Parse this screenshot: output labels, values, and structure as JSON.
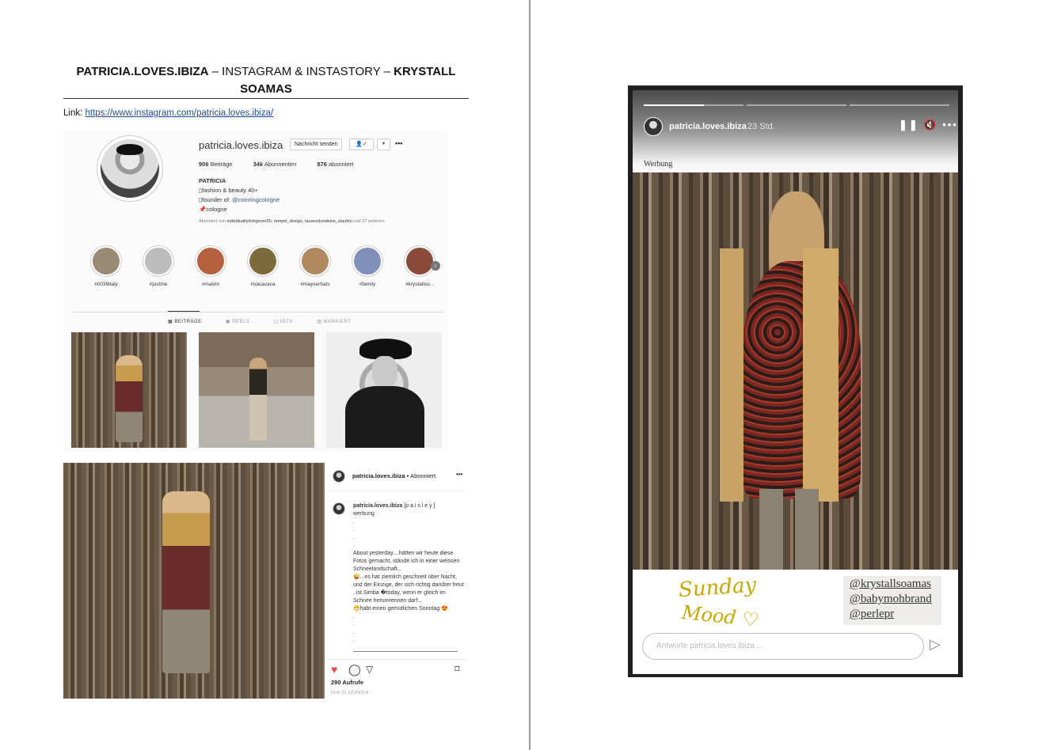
{
  "document": {
    "title_part1": "PATRICIA.LOVES.IBIZA",
    "title_part2": " – INSTAGRAM & INSTASTORY – ",
    "title_part3": "KRYSTALL SOAMAS",
    "link_label": "Link: ",
    "link_url": "https://www.instagram.com/patricia.loves.ibiza/"
  },
  "profile": {
    "username": "patricia.loves.ibiza",
    "message_button": "Nachricht senden",
    "follow_button": "👤✓",
    "dropdown_button": "▾",
    "more_button": "•••",
    "posts_count": "906",
    "posts_label": " Beiträge",
    "followers_count": "34k",
    "followers_label": " Abonnenten",
    "following_count": "876",
    "following_label": " abonniert",
    "bio_name": "PATRICIA",
    "bio_line1": "▯fashion & beauty 40+",
    "bio_line2_prefix": "▯founder of: ",
    "bio_line2_mention": "@coinringcologne",
    "bio_line3": "📌cologne",
    "followed_by_prefix": "Abonniert von ",
    "followed_by_names": "individuallylivingover50, rempel_design, tausendundeins_staufen",
    "followed_by_suffix": " und 37 weiteren",
    "highlights": [
      {
        "label": "#0039italy",
        "color": "#9a8a74"
      },
      {
        "label": "#justme",
        "color": "#bcbcbc"
      },
      {
        "label": "#malvin",
        "color": "#b5603f"
      },
      {
        "label": "#vacavaca",
        "color": "#7d6a3c"
      },
      {
        "label": "#mayserhats",
        "color": "#b08a5e"
      },
      {
        "label": "#family",
        "color": "#7f8fb8"
      },
      {
        "label": "#krystallso...",
        "color": "#8a4a3a"
      }
    ],
    "next_arrow": "›",
    "tabs": [
      "▦ BEITRÄGE",
      "▣ REELS",
      "▢ IGTV",
      "▥ MARKIERT"
    ]
  },
  "post": {
    "username": "patricia.loves.ibiza",
    "follow_state": " • Abonniert",
    "more_button": "•••",
    "caption_user": "patricia.loves.ibiza",
    "caption_body": " [p a i s l e y ]\nwerbung\n.\n.\n.\n.\nAbout yesterday....hätten wir heute diese Fotos gemacht, stände ich in einer weissen Schneelandschaft...\n😜...es hat ziemlich geschneit über Nacht, und der Einzige, der sich richtig darüber freut , ist Simba �today, wenn er gleich im Schnee herumrennen darf...\n😁habt einen gemütlichen Sonntag 😍\n.\n.\n.\n.",
    "views_count": "290",
    "views_label": " Aufrufe",
    "time_ago": "VOR 23 STUNDEN"
  },
  "story": {
    "username": "patricia.loves.ibiza",
    "time": "23 Std.",
    "controls": "❚❚ 🔇 •••",
    "werbung": "Werbung",
    "sticker_line1": "Sunday",
    "sticker_line2": "Mood ♡",
    "tags": [
      "@krystallsoamas",
      "@babymohbrand",
      "@perlepr"
    ],
    "reply_placeholder": "Antworte patricia.loves.ibiza ...",
    "send_icon": "▷"
  }
}
